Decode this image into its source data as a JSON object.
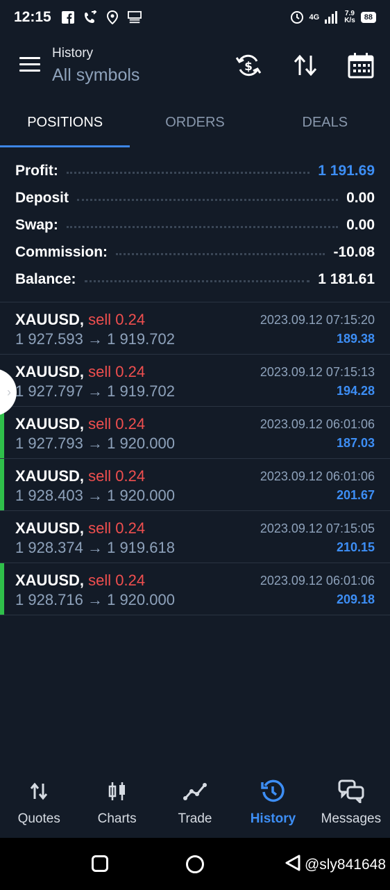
{
  "status_bar": {
    "time": "12:15",
    "network_label": "4G",
    "net_speed_value": "7.9",
    "net_speed_unit": "K/s",
    "battery": "88"
  },
  "header": {
    "title": "History",
    "subtitle": "All symbols"
  },
  "tabs": [
    {
      "label": "POSITIONS",
      "active": true
    },
    {
      "label": "ORDERS",
      "active": false
    },
    {
      "label": "DEALS",
      "active": false
    }
  ],
  "summary": {
    "profit_label": "Profit:",
    "profit_value": "1 191.69",
    "deposit_label": "Deposit",
    "deposit_value": "0.00",
    "swap_label": "Swap:",
    "swap_value": "0.00",
    "commission_label": "Commission:",
    "commission_value": "-10.08",
    "balance_label": "Balance:",
    "balance_value": "1 181.61"
  },
  "positions": [
    {
      "symbol": "XAUUSD,",
      "side": "sell 0.24",
      "prices": "1 927.593 → 1 919.702",
      "time": "2023.09.12 07:15:20",
      "profit": "189.38",
      "marked": false
    },
    {
      "symbol": "XAUUSD,",
      "side": "sell 0.24",
      "prices": "1 927.797 → 1 919.702",
      "time": "2023.09.12 07:15:13",
      "profit": "194.28",
      "marked": false
    },
    {
      "symbol": "XAUUSD,",
      "side": "sell 0.24",
      "prices": "1 927.793 → 1 920.000",
      "time": "2023.09.12 06:01:06",
      "profit": "187.03",
      "marked": true
    },
    {
      "symbol": "XAUUSD,",
      "side": "sell 0.24",
      "prices": "1 928.403 → 1 920.000",
      "time": "2023.09.12 06:01:06",
      "profit": "201.67",
      "marked": true
    },
    {
      "symbol": "XAUUSD,",
      "side": "sell 0.24",
      "prices": "1 928.374 → 1 919.618",
      "time": "2023.09.12 07:15:05",
      "profit": "210.15",
      "marked": false
    },
    {
      "symbol": "XAUUSD,",
      "side": "sell 0.24",
      "prices": "1 928.716 → 1 920.000",
      "time": "2023.09.12 06:01:06",
      "profit": "209.18",
      "marked": true
    }
  ],
  "bottom_nav": [
    {
      "label": "Quotes",
      "icon": "quotes-icon",
      "active": false
    },
    {
      "label": "Charts",
      "icon": "charts-icon",
      "active": false
    },
    {
      "label": "Trade",
      "icon": "trade-icon",
      "active": false
    },
    {
      "label": "History",
      "icon": "history-icon",
      "active": true
    },
    {
      "label": "Messages",
      "icon": "messages-icon",
      "active": false
    }
  ],
  "watermark": "@sly841648",
  "colors": {
    "background": "#131b27",
    "accent_blue": "#3d8ef5",
    "sell_red": "#f04f4f",
    "marker_green": "#2fbf4a"
  }
}
